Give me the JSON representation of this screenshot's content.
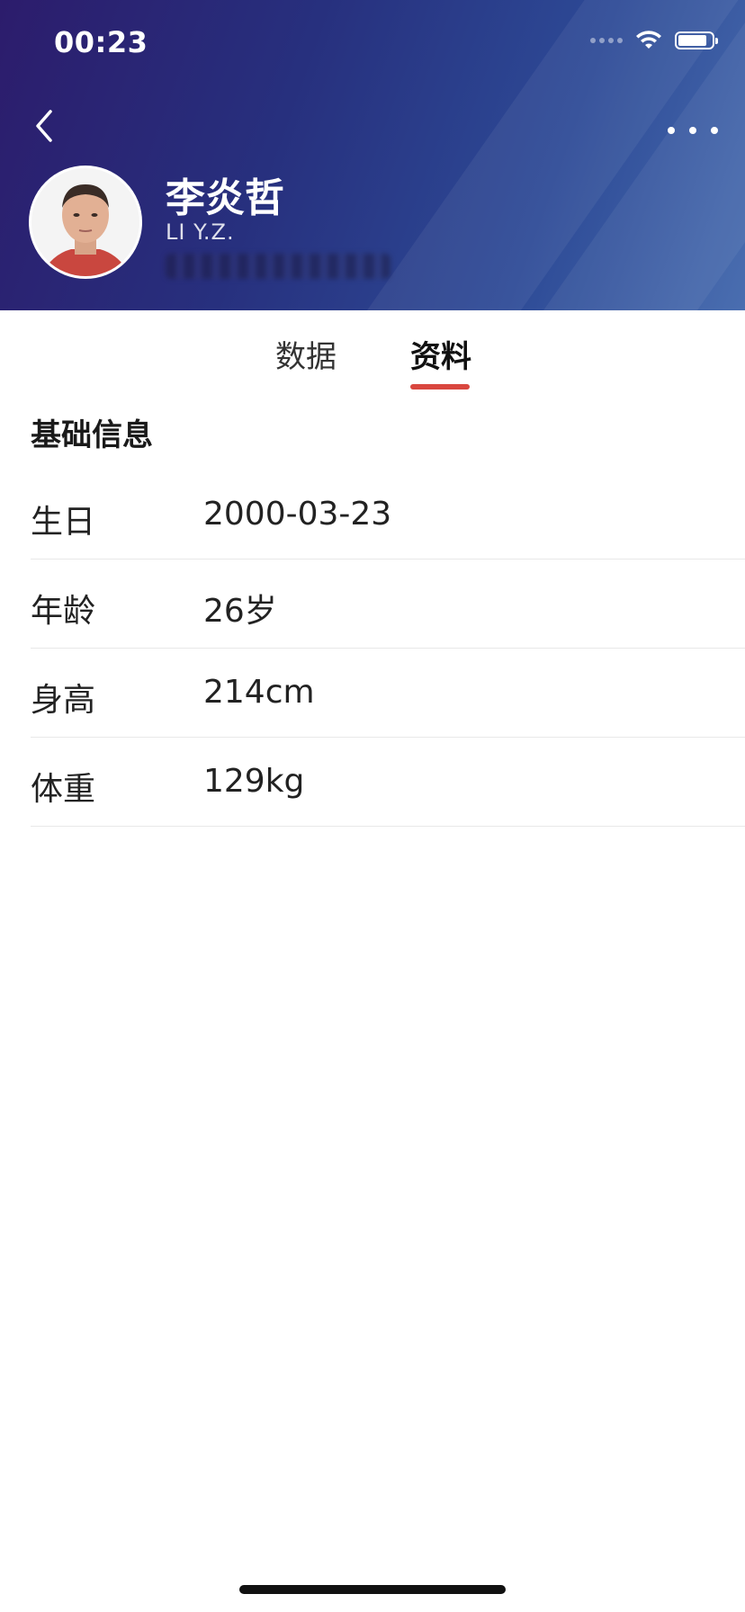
{
  "status_bar": {
    "time": "00:23",
    "battery_level": 0.85
  },
  "header": {
    "player_name": "李炎哲",
    "player_latin": "LI Y.Z.",
    "back_icon": "chevron-left-icon",
    "more_icon": "more-dots-icon"
  },
  "tabs": [
    {
      "label": "数据",
      "active": false
    },
    {
      "label": "资料",
      "active": true
    }
  ],
  "tab_accent_color": "#d9473f",
  "section": {
    "title": "基础信息",
    "rows": [
      {
        "label": "生日",
        "value": "2000-03-23"
      },
      {
        "label": "年龄",
        "value": "26岁"
      },
      {
        "label": "身高",
        "value": "214cm"
      },
      {
        "label": "体重",
        "value": "129kg"
      }
    ]
  }
}
